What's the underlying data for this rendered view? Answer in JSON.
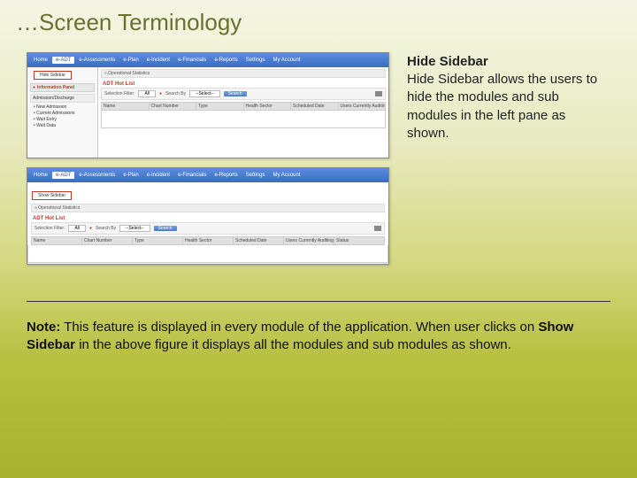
{
  "title": "…Screen Terminology",
  "desc": {
    "heading": "Hide Sidebar",
    "body": "Hide Sidebar allows the users to hide the modules and sub modules in the left pane as shown."
  },
  "shot_a": {
    "menu": [
      "Home",
      "e-ADT",
      "e-Assessments",
      "e-Plan",
      "e-Incident",
      "e-Financials",
      "e-Reports",
      "Settings",
      "My Account"
    ],
    "menu_active_index": 1,
    "toggle_label": "Hide Sidebar",
    "sidebar_section": "Information Panel",
    "sidebar_sub": "Admission/Discharge",
    "links": [
      "New Admission",
      "Current Admissions",
      "Wait Entry",
      "Wait Data"
    ],
    "section": "» Operational Statistics",
    "red_title": "ADT Hot List",
    "filter": {
      "label1": "Selection Filter:",
      "val1": "All",
      "label2": "Search By",
      "val2": "--Select--",
      "button": "Search"
    },
    "grid_cols": [
      "Name",
      "Chart Number",
      "Type",
      "Health Sector",
      "Scheduled Date",
      "Users Currently Auditing"
    ]
  },
  "shot_b": {
    "menu": [
      "Home",
      "e-ADT",
      "e-Assessments",
      "e-Plan",
      "e-Incident",
      "e-Financials",
      "e-Reports",
      "Settings",
      "My Account"
    ],
    "menu_active_index": 1,
    "toggle_label": "Show Sidebar",
    "section": "» Operational Statistics",
    "red_title": "ADT Hot List",
    "filter": {
      "label1": "Selection Filter:",
      "val1": "All",
      "label2": "Search By",
      "val2": "--Select--",
      "button": "Search"
    },
    "grid_cols": [
      "Name",
      "Chart Number",
      "Type",
      "Health Sector",
      "Scheduled Date",
      "Users Currently Auditing",
      "Status"
    ]
  },
  "note": {
    "label": "Note:",
    "t1": " This feature is displayed in every module of the application. When user clicks on ",
    "bold": "Show Sidebar",
    "t2": " in the above figure it displays all the modules and sub modules as shown."
  }
}
